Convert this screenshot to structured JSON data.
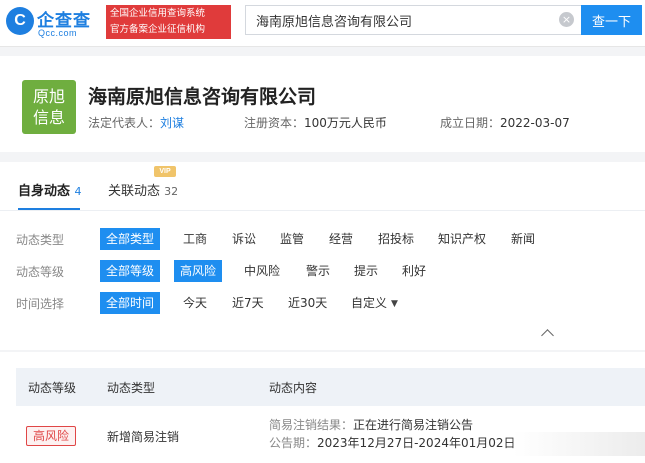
{
  "header": {
    "logo_cn": "企查查",
    "logo_en": "Qcc.com",
    "logo_mark": "C",
    "promo_line1": "全国企业信用查询系统",
    "promo_line2": "官方备案企业征信机构",
    "search_value": "海南原旭信息咨询有限公司",
    "search_button": "查一下",
    "clear_icon": "×"
  },
  "company": {
    "avatar_line1": "原旭",
    "avatar_line2": "信息",
    "avatar_color": "#6fae3f",
    "name": "海南原旭信息咨询有限公司",
    "legal_rep_label": "法定代表人：",
    "legal_rep": "刘谋",
    "capital_label": "注册资本：",
    "capital": "100万元人民币",
    "founded_label": "成立日期：",
    "founded": "2022-03-07"
  },
  "tabs": [
    {
      "label": "自身动态",
      "count": "4",
      "active": true
    },
    {
      "label": "关联动态",
      "count": "32",
      "badge": "VIP",
      "active": false
    }
  ],
  "filters": [
    {
      "label": "动态类型",
      "options": [
        "全部类型",
        "工商",
        "诉讼",
        "监管",
        "经营",
        "招投标",
        "知识产权",
        "新闻"
      ],
      "selected": [
        "全部类型"
      ]
    },
    {
      "label": "动态等级",
      "options": [
        "全部等级",
        "高风险",
        "中风险",
        "警示",
        "提示",
        "利好"
      ],
      "selected": [
        "全部等级",
        "高风险"
      ]
    },
    {
      "label": "时间选择",
      "options": [
        "全部时间",
        "今天",
        "近7天",
        "近30天",
        "自定义"
      ],
      "selected": [
        "全部时间"
      ]
    }
  ],
  "table": {
    "headers": [
      "动态等级",
      "动态类型",
      "动态内容"
    ],
    "rows": [
      {
        "level": "高风险",
        "type": "新增简易注销",
        "content_label1": "简易注销结果：",
        "content_value1": "正在进行简易注销公告",
        "content_label2": "公告期：",
        "content_value2": "2023年12月27日-2024年01月02日"
      }
    ]
  },
  "colors": {
    "accent": "#1e8ef0",
    "promo": "#e03b3b",
    "risk": "#e04646"
  }
}
